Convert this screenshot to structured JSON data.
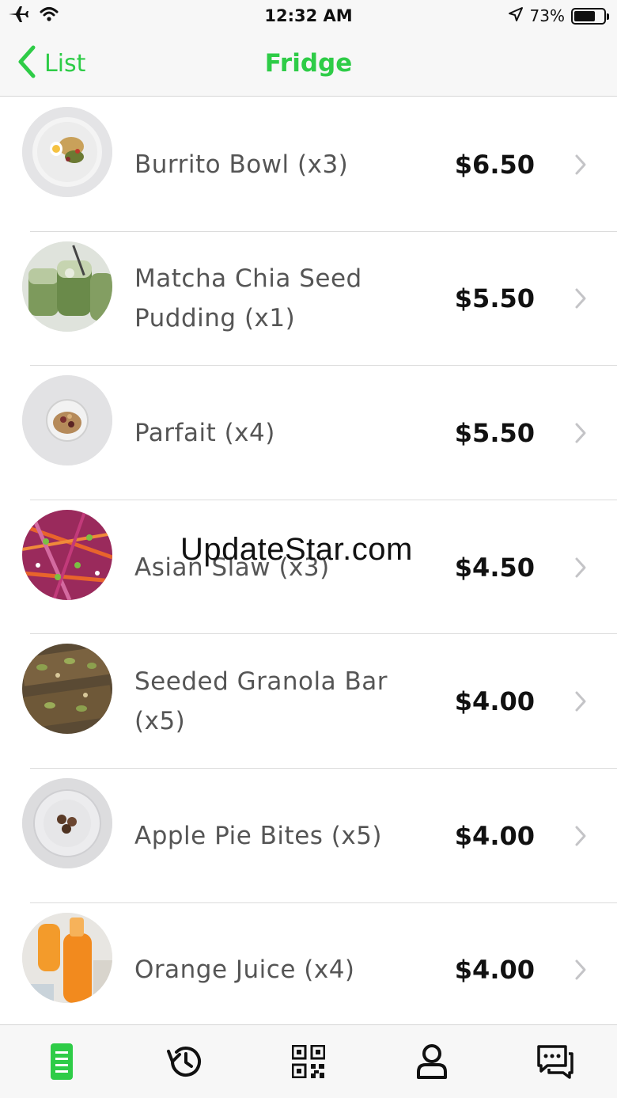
{
  "status_bar": {
    "time": "12:32 AM",
    "battery_text": "73%",
    "battery_level": 0.73,
    "icons": [
      "airplane-icon",
      "wifi-icon",
      "location-arrow-icon",
      "battery-icon"
    ]
  },
  "nav": {
    "back_label": "List",
    "title": "Fridge",
    "accent_color": "#2ecc47"
  },
  "items": [
    {
      "name": "Burrito Bowl (x3)",
      "price": "$6.50",
      "image": "burrito-bowl-image"
    },
    {
      "name": "Matcha Chia Seed Pudding (x1)",
      "price": "$5.50",
      "image": "matcha-chia-pudding-image"
    },
    {
      "name": "Parfait (x4)",
      "price": "$5.50",
      "image": "parfait-image"
    },
    {
      "name": "Asian Slaw (x3)",
      "price": "$4.50",
      "image": "asian-slaw-image"
    },
    {
      "name": "Seeded Granola Bar (x5)",
      "price": "$4.00",
      "image": "granola-bar-image"
    },
    {
      "name": "Apple Pie Bites (x5)",
      "price": "$4.00",
      "image": "apple-pie-bites-image"
    },
    {
      "name": "Orange Juice (x4)",
      "price": "$4.00",
      "image": "orange-juice-image"
    }
  ],
  "watermark": "UpdateStar.com",
  "tabs": [
    {
      "icon": "fridge-list-icon",
      "active": true
    },
    {
      "icon": "history-icon",
      "active": false
    },
    {
      "icon": "qr-code-icon",
      "active": false
    },
    {
      "icon": "profile-icon",
      "active": false
    },
    {
      "icon": "chat-icon",
      "active": false
    }
  ]
}
